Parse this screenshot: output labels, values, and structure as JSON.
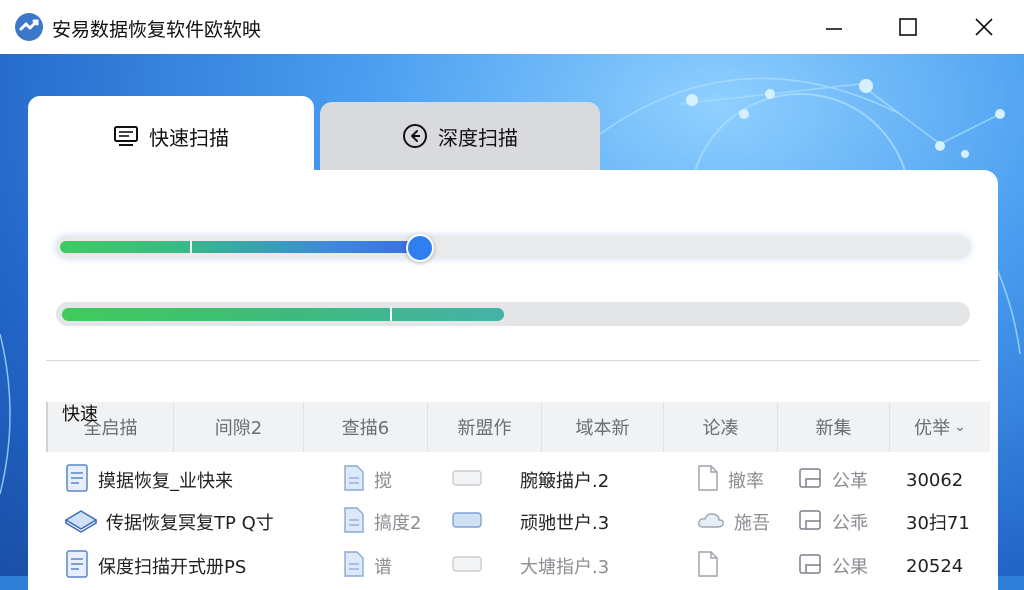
{
  "window": {
    "title": "安易数据恢复软件欧软映",
    "minimize_glyph": "—",
    "maximize_glyph": "☐",
    "close_glyph": "✕"
  },
  "tabs": [
    {
      "label": "快速扫描",
      "icon": "monitor-icon",
      "active": true
    },
    {
      "label": "深度扫描",
      "icon": "back-circle-icon",
      "active": false
    }
  ],
  "scan_slider": {
    "value_fraction": 0.39
  },
  "scan_progress": {
    "value_fraction": 0.49
  },
  "section_label": "快速",
  "table": {
    "columns": [
      "全启描",
      "间隙2",
      "查描6",
      "新盟作",
      "域本新",
      "论凑",
      "新集",
      "优举"
    ],
    "sort_indicator": "⌄",
    "rows": [
      {
        "name": "摸据恢复_业快来",
        "name_icon": "document-icon",
        "type": "搅",
        "type_icon": "file-icon",
        "scan_name": "腕簸描户.2",
        "status": "撤率",
        "status_icon": "page-icon",
        "group": "公革",
        "group_icon": "folder-icon",
        "size": "30062"
      },
      {
        "name": "传据恢复冥复TP Q寸",
        "name_icon": "disk-icon",
        "type": "搞度2",
        "type_icon": "file-icon",
        "scan_name": "顽驰世户.3",
        "status": "施吾",
        "status_icon": "cloud-icon",
        "group": "公乖",
        "group_icon": "folder-icon",
        "size": "30扫71"
      },
      {
        "name": "保度扫描开式册PS",
        "name_icon": "document-icon",
        "type": "谱",
        "type_icon": "file-icon",
        "scan_name": "大塘指户.3",
        "status": "",
        "status_icon": "page-icon",
        "group": "公果",
        "group_icon": "folder-icon",
        "size": "20524"
      }
    ]
  },
  "colors": {
    "accent_blue": "#2f7ff0",
    "progress_green": "#3fcc5b",
    "tab_inactive": "#d9dade",
    "background_blue": "#2f7fd6"
  }
}
